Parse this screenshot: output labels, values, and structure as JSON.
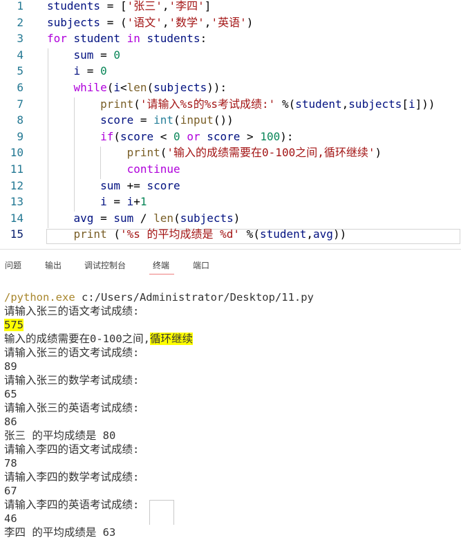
{
  "editor": {
    "lines": [
      {
        "n": "1",
        "tokens": [
          [
            "var",
            "students"
          ],
          [
            "op",
            " = ["
          ],
          [
            "str",
            "'张三'"
          ],
          [
            "op",
            ","
          ],
          [
            "str",
            "'李四'"
          ],
          [
            "op",
            "]"
          ]
        ]
      },
      {
        "n": "2",
        "tokens": [
          [
            "var",
            "subjects"
          ],
          [
            "op",
            " = ("
          ],
          [
            "str",
            "'语文'"
          ],
          [
            "op",
            ","
          ],
          [
            "str",
            "'数学'"
          ],
          [
            "op",
            ","
          ],
          [
            "str",
            "'英语'"
          ],
          [
            "op",
            ")"
          ]
        ]
      },
      {
        "n": "3",
        "tokens": [
          [
            "kw",
            "for"
          ],
          [
            "var",
            " student "
          ],
          [
            "kw",
            "in"
          ],
          [
            "var",
            " students"
          ],
          [
            "op",
            ":"
          ]
        ]
      },
      {
        "n": "4",
        "tokens": [
          [
            "op",
            "    "
          ],
          [
            "var",
            "sum"
          ],
          [
            "op",
            " = "
          ],
          [
            "num",
            "0"
          ]
        ]
      },
      {
        "n": "5",
        "tokens": [
          [
            "op",
            "    "
          ],
          [
            "var",
            "i"
          ],
          [
            "op",
            " = "
          ],
          [
            "num",
            "0"
          ]
        ]
      },
      {
        "n": "6",
        "tokens": [
          [
            "op",
            "    "
          ],
          [
            "kw",
            "while"
          ],
          [
            "op",
            "("
          ],
          [
            "var",
            "i"
          ],
          [
            "op",
            "<"
          ],
          [
            "fn",
            "len"
          ],
          [
            "op",
            "("
          ],
          [
            "var",
            "subjects"
          ],
          [
            "op",
            "))"
          ],
          [
            "op",
            ":"
          ]
        ]
      },
      {
        "n": "7",
        "tokens": [
          [
            "op",
            "        "
          ],
          [
            "fn",
            "print"
          ],
          [
            "op",
            "("
          ],
          [
            "str",
            "'请输入%s的%s考试成绩:'"
          ],
          [
            "op",
            " %("
          ],
          [
            "var",
            "student"
          ],
          [
            "op",
            ","
          ],
          [
            "var",
            "subjects"
          ],
          [
            "op",
            "["
          ],
          [
            "var",
            "i"
          ],
          [
            "op",
            "]))"
          ]
        ]
      },
      {
        "n": "8",
        "tokens": [
          [
            "op",
            "        "
          ],
          [
            "var",
            "score"
          ],
          [
            "op",
            " = "
          ],
          [
            "bi",
            "int"
          ],
          [
            "op",
            "("
          ],
          [
            "fn",
            "input"
          ],
          [
            "op",
            "())"
          ]
        ]
      },
      {
        "n": "9",
        "tokens": [
          [
            "op",
            "        "
          ],
          [
            "kw",
            "if"
          ],
          [
            "op",
            "("
          ],
          [
            "var",
            "score"
          ],
          [
            "op",
            " < "
          ],
          [
            "num",
            "0"
          ],
          [
            "op",
            " "
          ],
          [
            "kw",
            "or"
          ],
          [
            "op",
            " "
          ],
          [
            "var",
            "score"
          ],
          [
            "op",
            " > "
          ],
          [
            "num",
            "100"
          ],
          [
            "op",
            "):"
          ]
        ]
      },
      {
        "n": "10",
        "tokens": [
          [
            "op",
            "            "
          ],
          [
            "fn",
            "print"
          ],
          [
            "op",
            "("
          ],
          [
            "str",
            "'输入的成绩需要在0-100之间,循环继续'"
          ],
          [
            "op",
            ")"
          ]
        ]
      },
      {
        "n": "11",
        "tokens": [
          [
            "op",
            "            "
          ],
          [
            "kw",
            "continue"
          ]
        ]
      },
      {
        "n": "12",
        "tokens": [
          [
            "op",
            "        "
          ],
          [
            "var",
            "sum"
          ],
          [
            "op",
            " += "
          ],
          [
            "var",
            "score"
          ]
        ]
      },
      {
        "n": "13",
        "tokens": [
          [
            "op",
            "        "
          ],
          [
            "var",
            "i"
          ],
          [
            "op",
            " = "
          ],
          [
            "var",
            "i"
          ],
          [
            "op",
            "+"
          ],
          [
            "num",
            "1"
          ]
        ]
      },
      {
        "n": "14",
        "tokens": [
          [
            "op",
            "    "
          ],
          [
            "var",
            "avg"
          ],
          [
            "op",
            " = "
          ],
          [
            "var",
            "sum"
          ],
          [
            "op",
            " / "
          ],
          [
            "fn",
            "len"
          ],
          [
            "op",
            "("
          ],
          [
            "var",
            "subjects"
          ],
          [
            "op",
            ")"
          ]
        ]
      },
      {
        "n": "15",
        "tokens": [
          [
            "op",
            "    "
          ],
          [
            "fn",
            "print"
          ],
          [
            "op",
            " ("
          ],
          [
            "str",
            "'%s 的平均成绩是 %d'"
          ],
          [
            "op",
            " %("
          ],
          [
            "var",
            "student"
          ],
          [
            "op",
            ","
          ],
          [
            "var",
            "avg"
          ],
          [
            "op",
            "))"
          ]
        ]
      }
    ]
  },
  "panel": {
    "tabs": [
      {
        "label": "问题",
        "active": false
      },
      {
        "label": "输出",
        "active": false
      },
      {
        "label": "调试控制台",
        "active": false
      },
      {
        "label": "终端",
        "active": true
      },
      {
        "label": "端口",
        "active": false
      }
    ]
  },
  "terminal": {
    "path_prefix": "/python.exe",
    "path_rest": " c:/Users/Administrator/Desktop/11.py",
    "lines": [
      {
        "text": "请输入张三的语文考试成绩:"
      },
      {
        "text": "575",
        "highlight": true
      },
      {
        "text": "输入的成绩需要在0-100之间,",
        "tail": "循环继续",
        "tail_highlight": true
      },
      {
        "text": "请输入张三的语文考试成绩:"
      },
      {
        "text": "89"
      },
      {
        "text": "请输入张三的数学考试成绩:"
      },
      {
        "text": "65"
      },
      {
        "text": "请输入张三的英语考试成绩:"
      },
      {
        "text": "86"
      },
      {
        "text": "张三 的平均成绩是 80"
      },
      {
        "text": "请输入李四的语文考试成绩:"
      },
      {
        "text": "78"
      },
      {
        "text": "请输入李四的数学考试成绩:"
      },
      {
        "text": "67"
      },
      {
        "text": "请输入李四的英语考试成绩:"
      },
      {
        "text": "46"
      },
      {
        "text": "李四 的平均成绩是 63"
      }
    ]
  },
  "colors": {
    "keyword": "#af00db",
    "function": "#795e26",
    "string": "#a31515",
    "number": "#098658",
    "variable": "#001080",
    "highlight": "#ffff00",
    "active_tab_underline": "#ee7e7e"
  }
}
